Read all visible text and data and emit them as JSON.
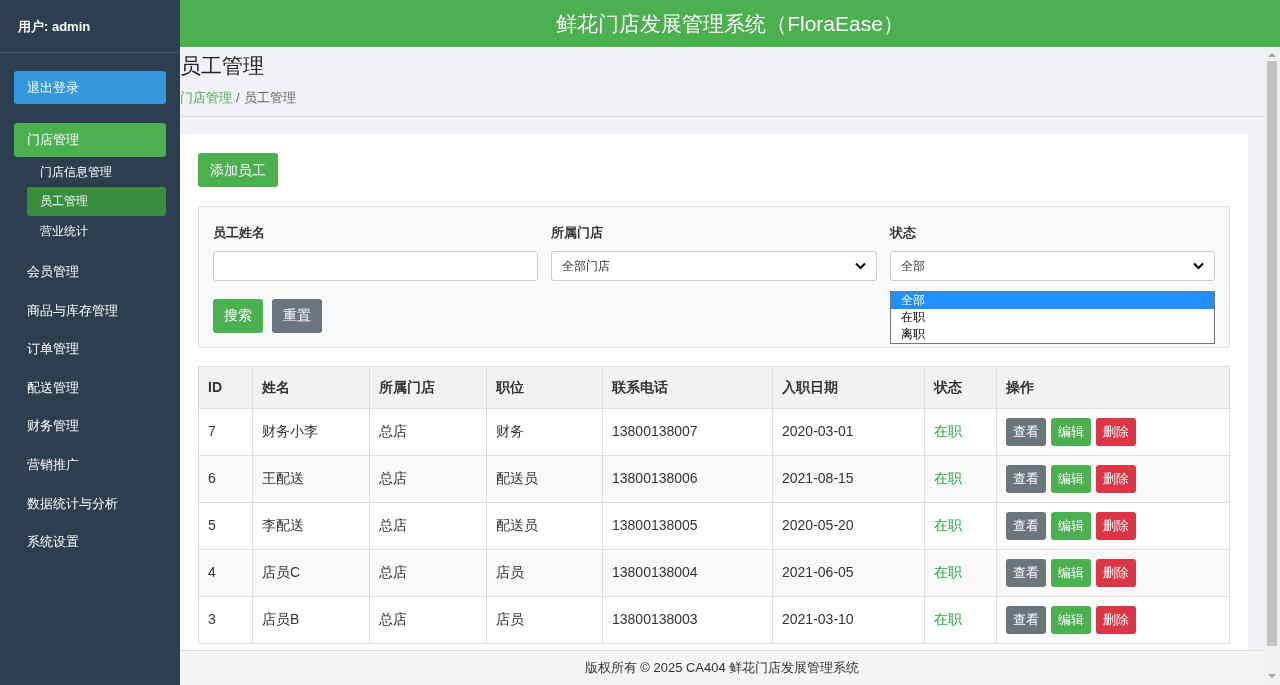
{
  "header": {
    "title": "鲜花门店发展管理系统（FloraEase）"
  },
  "sidebar": {
    "user": "用户: admin",
    "logout": "退出登录",
    "items": [
      {
        "label": "门店管理",
        "selected": true,
        "children": [
          {
            "label": "门店信息管理",
            "selected": false
          },
          {
            "label": "员工管理",
            "selected": true
          },
          {
            "label": "营业统计",
            "selected": false
          }
        ]
      },
      {
        "label": "会员管理",
        "selected": false
      },
      {
        "label": "商品与库存管理",
        "selected": false
      },
      {
        "label": "订单管理",
        "selected": false
      },
      {
        "label": "配送管理",
        "selected": false
      },
      {
        "label": "财务管理",
        "selected": false
      },
      {
        "label": "营销推广",
        "selected": false
      },
      {
        "label": "数据统计与分析",
        "selected": false
      },
      {
        "label": "系统设置",
        "selected": false
      }
    ]
  },
  "page": {
    "title": "员工管理",
    "breadcrumb": [
      {
        "label": "门店管理",
        "link": true
      },
      {
        "label": "员工管理",
        "link": false
      }
    ],
    "separator": "/"
  },
  "add_button": "添加员工",
  "filters": {
    "name": {
      "label": "员工姓名"
    },
    "store": {
      "label": "所属门店",
      "value": "全部门店"
    },
    "status": {
      "label": "状态",
      "value": "全部",
      "expanded": true,
      "options": [
        {
          "label": "全部",
          "selected": true
        },
        {
          "label": "在职",
          "selected": false
        },
        {
          "label": "离职",
          "selected": false
        }
      ]
    },
    "search": "搜索",
    "reset": "重置"
  },
  "table": {
    "columns": [
      "ID",
      "姓名",
      "所属门店",
      "职位",
      "联系电话",
      "入职日期",
      "状态",
      "操作"
    ],
    "rows": [
      {
        "id": "7",
        "name": "财务小李",
        "store": "总店",
        "position": "财务",
        "phone": "13800138007",
        "date": "2020-03-01",
        "status": "在职",
        "active": true,
        "actions": [
          "查看",
          "编辑",
          "删除"
        ]
      },
      {
        "id": "6",
        "name": "王配送",
        "store": "总店",
        "position": "配送员",
        "phone": "13800138006",
        "date": "2021-08-15",
        "status": "在职",
        "active": true,
        "actions": [
          "查看",
          "编辑",
          "删除"
        ]
      },
      {
        "id": "5",
        "name": "李配送",
        "store": "总店",
        "position": "配送员",
        "phone": "13800138005",
        "date": "2020-05-20",
        "status": "在职",
        "active": true,
        "actions": [
          "查看",
          "编辑",
          "删除"
        ]
      },
      {
        "id": "4",
        "name": "店员C",
        "store": "总店",
        "position": "店员",
        "phone": "13800138004",
        "date": "2021-06-05",
        "status": "在职",
        "active": true,
        "actions": [
          "查看",
          "编辑",
          "删除"
        ]
      },
      {
        "id": "3",
        "name": "店员B",
        "store": "总店",
        "position": "店员",
        "phone": "13800138003",
        "date": "2021-03-10",
        "status": "在职",
        "active": true,
        "actions": [
          "查看",
          "编辑",
          "删除"
        ]
      }
    ]
  },
  "footer": "版权所有 © 2025 CA404 鲜花门店发展管理系统"
}
